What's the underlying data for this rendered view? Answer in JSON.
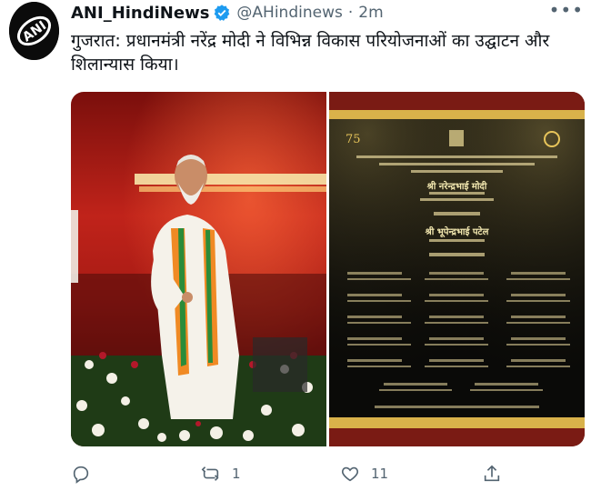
{
  "tweet": {
    "display_name": "ANI_HindiNews",
    "handle": "@AHindinews",
    "separator": "·",
    "time": "2m",
    "text": "गुजरात: प्रधानमंत्री नरेंद्र मोदी ने विभिन्न विकास परियोजनाओं का उद्घाटन और शिलान्यास किया।",
    "more_label": "•••"
  },
  "avatar": {
    "logo_text": "ANI"
  },
  "media": {
    "card": {
      "line_name_1": "श्री नरेन्द्रभाई मोदी",
      "line_name_2": "श्री भूपेन्द्रभाई पटेल"
    }
  },
  "actions": {
    "reply_count": "",
    "retweet_count": "1",
    "like_count": "11"
  },
  "colors": {
    "verified": "#1d9bf0",
    "muted": "#536471",
    "stage_red": "#c0231a",
    "card_black": "#0a0a08",
    "card_gold": "#d9b24a"
  }
}
